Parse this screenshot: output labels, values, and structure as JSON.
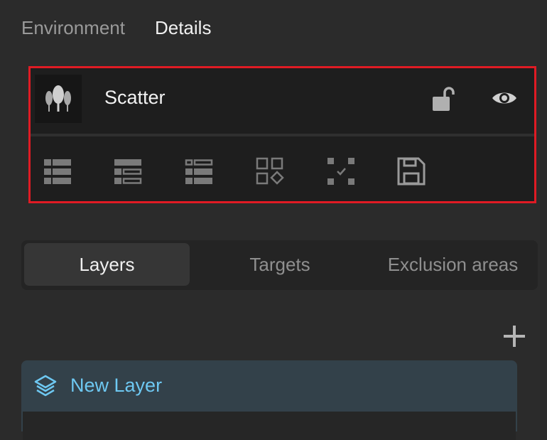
{
  "top_tabs": [
    {
      "label": "Environment",
      "active": false
    },
    {
      "label": "Details",
      "active": true
    }
  ],
  "scatter": {
    "title": "Scatter",
    "thumbnail_icon": "trees-icon",
    "lock_icon": "unlocked-padlock-icon",
    "visibility_icon": "eye-icon",
    "toolbar_icons": [
      "list-view-icon",
      "list-detail-icon",
      "list-compact-icon",
      "grid-shapes-icon",
      "select-corners-icon",
      "save-icon"
    ]
  },
  "sub_tabs": [
    {
      "label": "Layers",
      "active": true
    },
    {
      "label": "Targets",
      "active": false
    },
    {
      "label": "Exclusion areas",
      "active": false
    }
  ],
  "add_icon": "plus-icon",
  "layer": {
    "name": "New Layer",
    "icon": "layers-icon"
  },
  "colors": {
    "highlight_border": "#e01b24",
    "layer_name": "#6ec8f2",
    "layer_card": "#33414a"
  }
}
